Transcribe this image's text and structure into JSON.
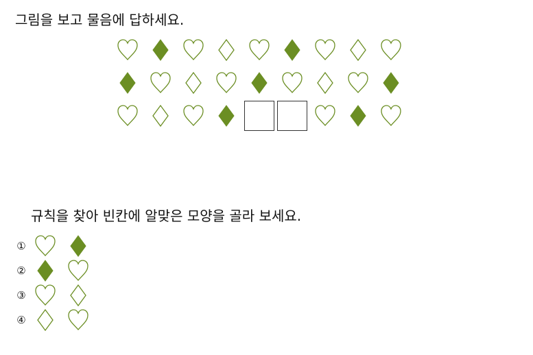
{
  "title": "그림을 보고 물음에 답하세요.",
  "question": "규칙을 찾아 빈칸에 알맞은 모양을 골라 보세요.",
  "colors": {
    "green": "#6b8e23"
  },
  "pattern": {
    "rows": [
      [
        "heart",
        "diamond-filled",
        "heart",
        "diamond-outline",
        "heart",
        "diamond-filled",
        "heart",
        "diamond-outline",
        "heart"
      ],
      [
        "diamond-filled",
        "heart",
        "diamond-outline",
        "heart",
        "diamond-filled",
        "heart",
        "diamond-outline",
        "heart",
        "diamond-filled"
      ],
      [
        "heart",
        "diamond-outline",
        "heart",
        "diamond-filled",
        "blank",
        "blank",
        "heart",
        "diamond-filled",
        "heart"
      ]
    ]
  },
  "options": [
    {
      "number": "①",
      "shapes": [
        "heart",
        "diamond-filled"
      ]
    },
    {
      "number": "②",
      "shapes": [
        "diamond-filled",
        "heart"
      ]
    },
    {
      "number": "③",
      "shapes": [
        "heart",
        "diamond-outline"
      ]
    },
    {
      "number": "④",
      "shapes": [
        "diamond-outline",
        "heart"
      ]
    }
  ]
}
